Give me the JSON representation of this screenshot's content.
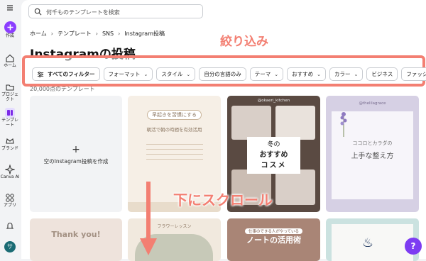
{
  "sidebar": {
    "items": [
      {
        "label": "作成"
      },
      {
        "label": "ホーム"
      },
      {
        "label": "プロジェクト"
      },
      {
        "label": "テンプレート"
      },
      {
        "label": "ブランド"
      },
      {
        "label": "Canva AI"
      },
      {
        "label": "アプリ"
      }
    ],
    "avatar_letter": "サ"
  },
  "search": {
    "placeholder": "何千ものテンプレートを検索"
  },
  "breadcrumb": {
    "items": [
      "ホーム",
      "テンプレート",
      "SNS",
      "Instagram投稿"
    ]
  },
  "page": {
    "title": "Instagramの投稿",
    "count": "20,000点のテンプレート"
  },
  "filters": {
    "items": [
      {
        "label": "すべてのフィルター"
      },
      {
        "label": "フォーマット"
      },
      {
        "label": "スタイル"
      },
      {
        "label": "自分の言語のみ"
      },
      {
        "label": "テーマ"
      },
      {
        "label": "おすすめ"
      },
      {
        "label": "カラー"
      },
      {
        "label": "ビジネス"
      },
      {
        "label": "ファッシ"
      }
    ]
  },
  "annotations": {
    "filter_caption": "絞り込み",
    "scroll_caption": "下にスクロール"
  },
  "cards": {
    "create_label": "空のInstagram投稿を作成",
    "plus": "+",
    "morning": {
      "title": "早起きを習慣にする",
      "subtitle": "朝活で朝の時間を有効活用"
    },
    "winter": {
      "line1": "冬の",
      "line2": "おすすめ",
      "line3": "コスメ",
      "handle": "@okaeri_kitchen"
    },
    "body": {
      "line1": "ココロとカラダの",
      "line2": "上手な整え方",
      "handle": "@thelilagrace"
    },
    "thanks": {
      "title": "Thank you!"
    },
    "note": {
      "title": "ノートの活用術",
      "subtitle": "仕事のできる人がやっている"
    },
    "lesson": {
      "label": "フラワーレッスン"
    }
  },
  "help": {
    "label": "?"
  },
  "colors": {
    "accent": "#f37f72",
    "brand": "#8b3dff"
  }
}
